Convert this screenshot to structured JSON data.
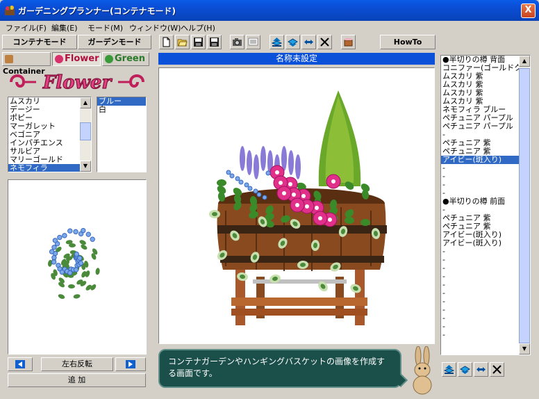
{
  "window": {
    "title": "ガーデニングプランナー(コンテナモード)",
    "close_label": "X"
  },
  "menu": [
    {
      "label": "ファイル(F)"
    },
    {
      "label": "編集(E)"
    },
    {
      "label": "モード(M)"
    },
    {
      "label": "ウィンドウ(W)"
    },
    {
      "label": "ヘルプ(H)"
    }
  ],
  "modes": {
    "container": "コンテナモード",
    "garden": "ガーデンモード"
  },
  "toolbar": {
    "icons": [
      "new-file-icon",
      "open-folder-icon",
      "save-icon",
      "save-as-icon",
      "camera-icon",
      "image-icon",
      "bring-front-icon",
      "send-back-icon",
      "flip-horizontal-icon",
      "delete-icon",
      "container-icon"
    ],
    "howto_label": "HowTo"
  },
  "categories": [
    {
      "label": "Container",
      "color": "#c08040"
    },
    {
      "label": "Flower",
      "color": "#d8306a"
    },
    {
      "label": "Green",
      "color": "#3a9a3a"
    }
  ],
  "banner_text": "Flower",
  "flower_list": {
    "items": [
      "ムスカリ",
      "デージー",
      "ポピー",
      "マーガレット",
      "ベゴニア",
      "インパチエンス",
      "サルビア",
      "マリーゴールド",
      "ネモフィラ"
    ],
    "selected_index": 8
  },
  "color_list": {
    "items": [
      "ブルー",
      "白"
    ],
    "selected_index": 0
  },
  "preview_controls": {
    "flip_label": "左右反転",
    "add_label": "追 加"
  },
  "canvas": {
    "title": "名称未設定"
  },
  "help_message": "コンテナガーデンやハンギングバスケットの画像を作成する画面です。",
  "layer_list": {
    "items": [
      "●半切りの樽 背面",
      "コニファー(ゴールドク",
      "ムスカリ 紫",
      "ムスカリ 紫",
      "ムスカリ 紫",
      "ムスカリ 紫",
      "ネモフィラ ブルー",
      "ペチュニア パープル",
      "ペチュニア パープル",
      "-",
      "ペチュニア 紫",
      "ペチュニア 紫",
      "アイビー(斑入り)",
      "-",
      "-",
      "-",
      "-",
      "●半切りの樽 前面",
      "-",
      "ペチュニア 紫",
      "ペチュニア 紫",
      "アイビー(斑入り)",
      "アイビー(斑入り)",
      "-",
      "-",
      "-",
      "-",
      "-",
      "-",
      "-",
      "-",
      "-",
      "-",
      "-"
    ],
    "selected_index": 12
  },
  "colors": {
    "title_bar": "#0b4fd8",
    "selection": "#316ac5",
    "bubble": "#1b4f4a"
  }
}
